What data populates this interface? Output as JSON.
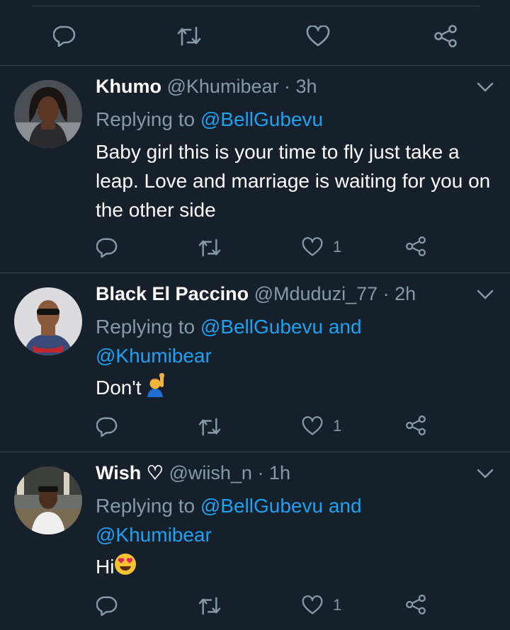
{
  "top_actions": {
    "reply_icon": "comment-icon",
    "retweet_icon": "retweet-icon",
    "like_icon": "heart-icon",
    "share_icon": "share-icon"
  },
  "tweets": [
    {
      "name": "Khumo",
      "meta": "@Khumibear · 3h",
      "replying_prefix": "Replying to ",
      "mentions": [
        "@BellGubevu"
      ],
      "text": "Baby girl this is your time to fly just take a leap. Love and marriage is waiting for you on the other side",
      "likes": "1"
    },
    {
      "name": "Black El Paccino",
      "meta": "@Mduduzi_77 · 2h",
      "replying_prefix": "Replying to ",
      "mentions": [
        "@BellGubevu",
        "@Khumibear"
      ],
      "joiner": " and",
      "text": "Don't",
      "emoji": "person-raising-hand-emoji",
      "likes": "1"
    },
    {
      "name": "Wish ♡",
      "meta": "@wiish_n · 1h",
      "replying_prefix": "Replying to ",
      "mentions": [
        "@BellGubevu",
        "@Khumibear"
      ],
      "joiner": " and",
      "text": "Hi",
      "emoji": "heart-eyes-emoji",
      "likes": "1"
    }
  ],
  "colors": {
    "background": "#15202b",
    "divider": "#38444d",
    "muted": "#8899a6",
    "link": "#1da1f2",
    "text": "#ffffff"
  }
}
